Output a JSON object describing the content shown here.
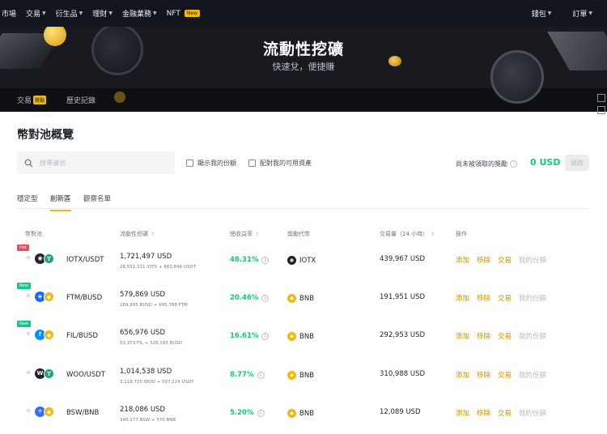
{
  "nav": {
    "items": [
      {
        "label": "市場",
        "caret": false
      },
      {
        "label": "交易",
        "caret": true
      },
      {
        "label": "衍生品",
        "caret": true
      },
      {
        "label": "理財",
        "caret": true
      },
      {
        "label": "金融業務",
        "caret": true
      },
      {
        "label": "NFT",
        "caret": false
      }
    ],
    "nft_badge": "New",
    "right": [
      {
        "label": "錢包"
      },
      {
        "label": "訂單"
      }
    ]
  },
  "hero": {
    "title": "流動性挖礦",
    "subtitle": "快速兌，便捷賺"
  },
  "hero_tabs": {
    "trade": "交易",
    "trade_badge": "獎勵",
    "history": "歷史記錄"
  },
  "page": {
    "title": "幣對池概覽",
    "search_placeholder": "搜尋礦池",
    "check_my_share": "顯示我的份額",
    "check_my_assets": "配對我的可用資產",
    "unclaimed_label": "尚未被領取的獎勵",
    "unclaimed_value": "0 USD",
    "claim_button": "領取"
  },
  "subtabs": [
    "穩定型",
    "創新區",
    "觀察名單"
  ],
  "active_subtab": 1,
  "table": {
    "headers": [
      "幣對池",
      "流動性挖礦",
      "總收益率",
      "獎勵代幣",
      "交易量（24 小時）",
      "操作"
    ],
    "actions": [
      "添加",
      "移除",
      "交易",
      "我的份額"
    ],
    "rows": [
      {
        "badge": "Hot",
        "badge_type": "hot",
        "pair": "IOTX/USDT",
        "coin1_color": "#1e2329",
        "coin1_glyph": "◉",
        "coin2_color": "#26a17b",
        "coin2_glyph": "T",
        "liquidity": "1,721,497 USD",
        "liquidity_sub": "28,551,331 IOTX + 860,846 USDT",
        "apy": "48.31%",
        "reward": "IOTX",
        "reward_color": "#1e2329",
        "reward_glyph": "◉",
        "volume": "439,967 USD"
      },
      {
        "badge": "New",
        "badge_type": "new",
        "pair": "FTM/BUSD",
        "coin1_color": "#1969ff",
        "coin1_glyph": "◈",
        "coin2_color": "#f0b90b",
        "coin2_glyph": "◆",
        "liquidity": "579,869 USD",
        "liquidity_sub": "289,995 BUSD + 995,788 FTM",
        "apy": "20.46%",
        "reward": "BNB",
        "reward_color": "#f0b90b",
        "reward_glyph": "◆",
        "volume": "191,951 USD"
      },
      {
        "badge": "New",
        "badge_type": "new",
        "pair": "FIL/BUSD",
        "coin1_color": "#0090ff",
        "coin1_glyph": "f",
        "coin2_color": "#f0b90b",
        "coin2_glyph": "◆",
        "liquidity": "656,976 USD",
        "liquidity_sub": "53,373 FIL + 328,193 BUSD",
        "apy": "16.61%",
        "reward": "BNB",
        "reward_color": "#f0b90b",
        "reward_glyph": "◆",
        "volume": "292,953 USD"
      },
      {
        "badge": "",
        "badge_type": "",
        "pair": "WOO/USDT",
        "coin1_color": "#1e2329",
        "coin1_glyph": "W",
        "coin2_color": "#26a17b",
        "coin2_glyph": "T",
        "liquidity": "1,014,538 USD",
        "liquidity_sub": "3,118,720 WOO + 507,224 USDT",
        "apy": "8.77%",
        "reward": "BNB",
        "reward_color": "#f0b90b",
        "reward_glyph": "◆",
        "volume": "310,988 USD"
      },
      {
        "badge": "",
        "badge_type": "",
        "pair": "BSW/BNB",
        "coin1_color": "#3b6cf6",
        "coin1_glyph": "✈",
        "coin2_color": "#f0b90b",
        "coin2_glyph": "◆",
        "liquidity": "218,086 USD",
        "liquidity_sub": "340,177 BSW + 370 BNB",
        "apy": "5.20%",
        "reward": "BNB",
        "reward_color": "#f0b90b",
        "reward_glyph": "◆",
        "volume": "12,089 USD"
      }
    ]
  }
}
